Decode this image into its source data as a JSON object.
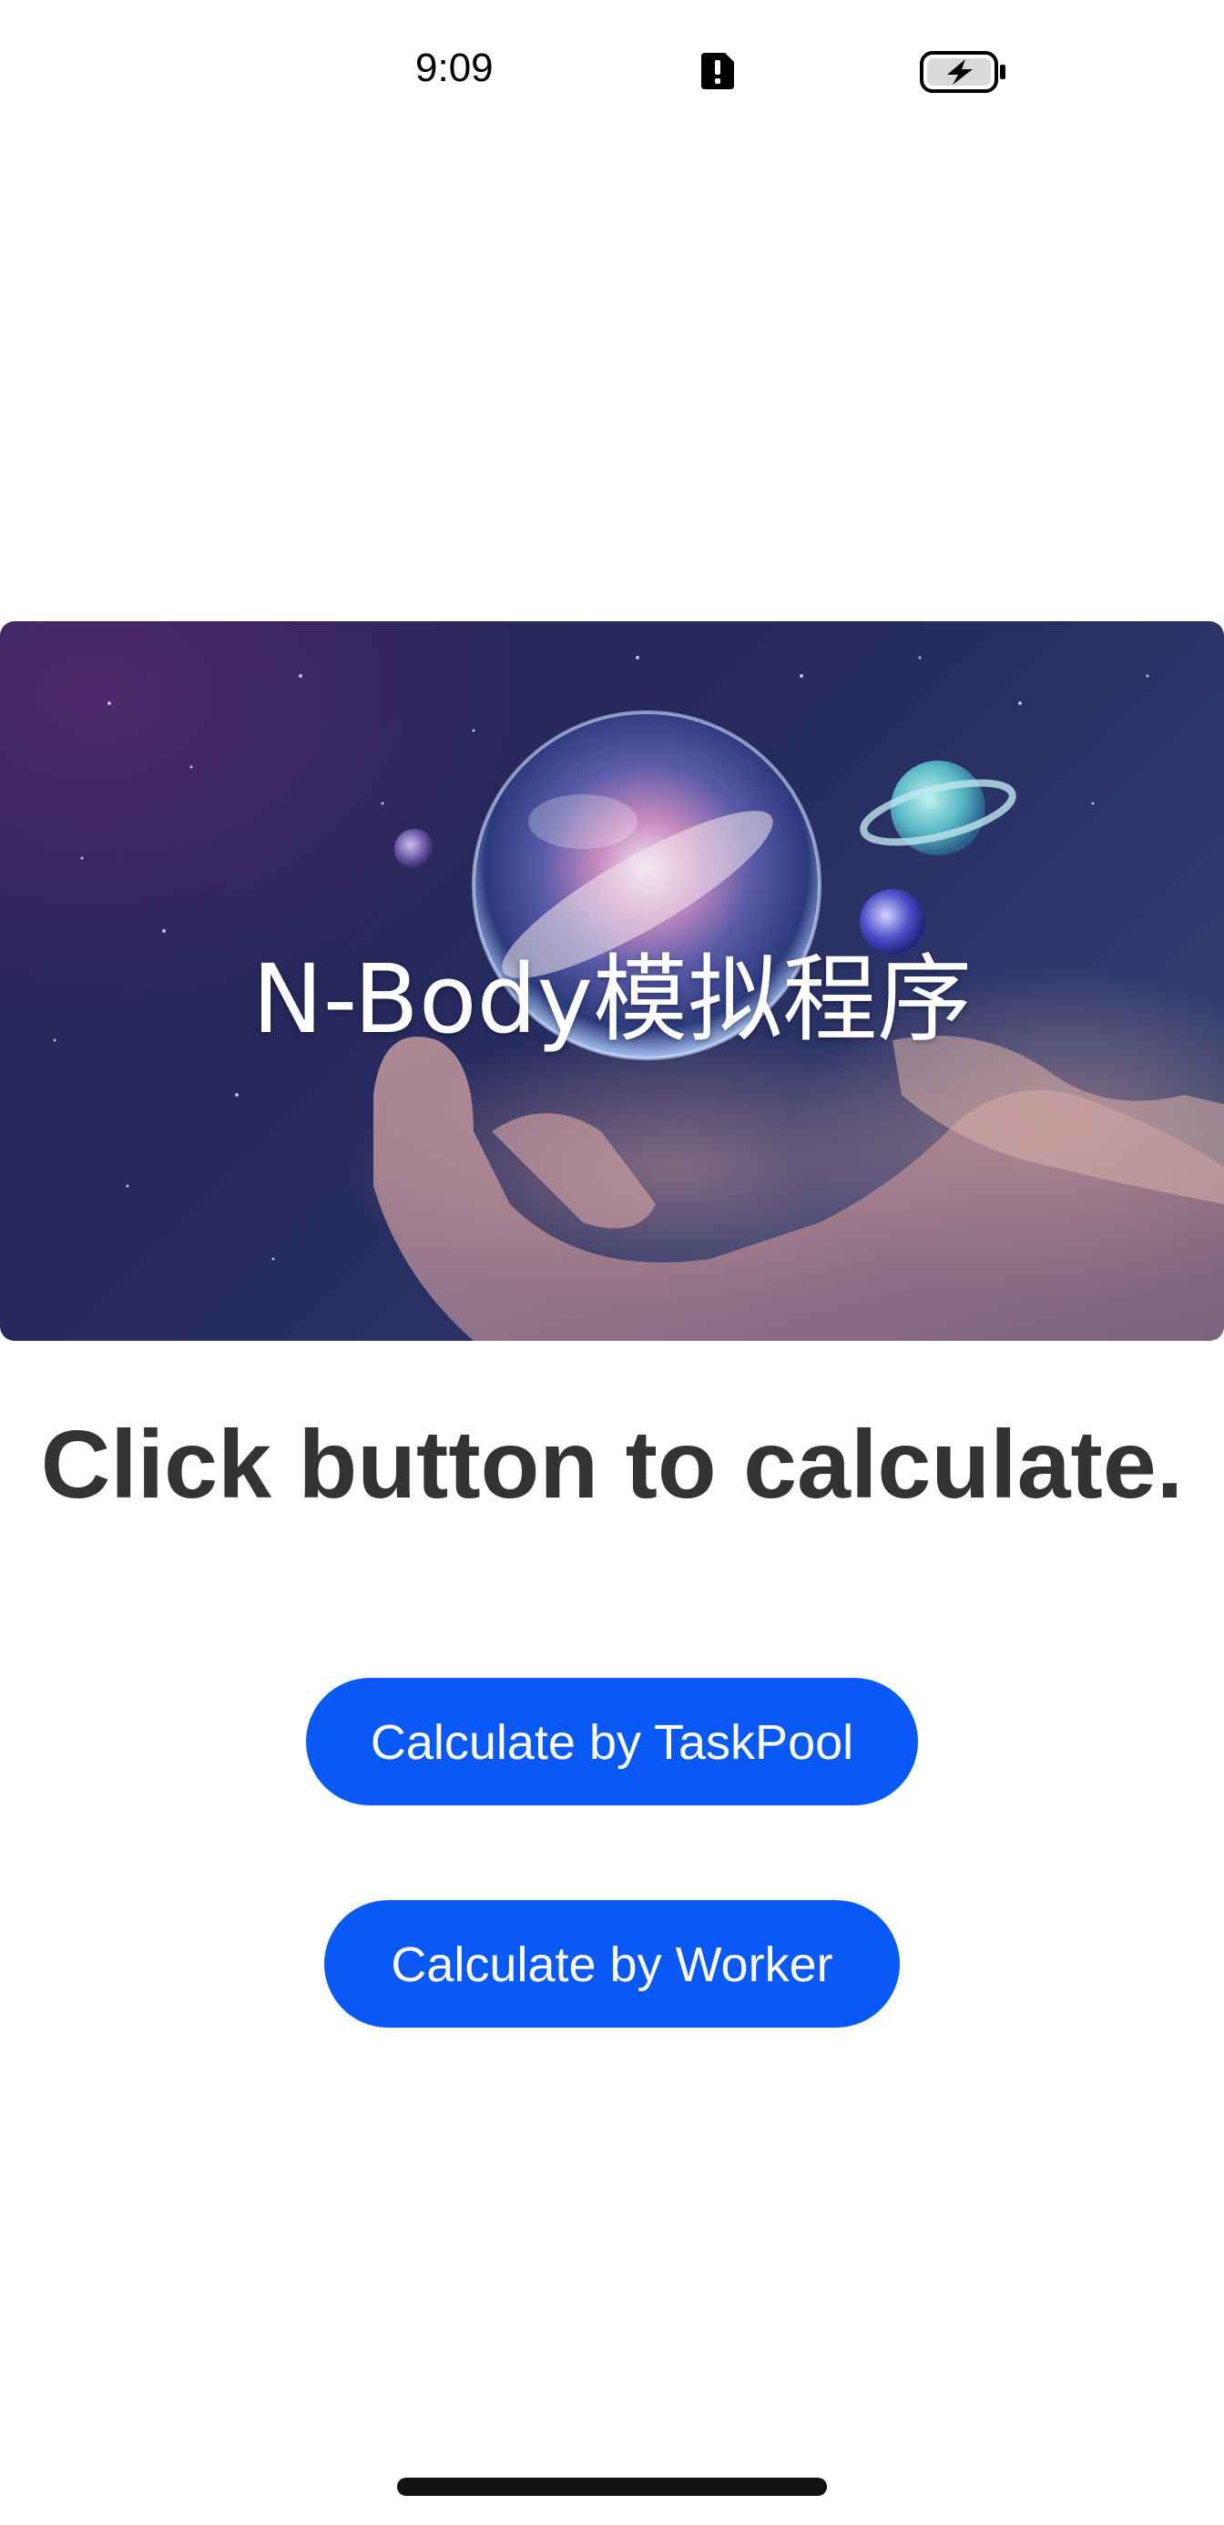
{
  "status_bar": {
    "time": "9:09",
    "icons": [
      "alert-icon",
      "battery-charging-icon"
    ]
  },
  "banner": {
    "title": "N-Body模拟程序",
    "image": "galaxy-in-hands-image"
  },
  "main": {
    "heading": "Click button to calculate.",
    "buttons": {
      "taskpool_label": "Calculate by TaskPool",
      "worker_label": "Calculate by Worker"
    }
  },
  "colors": {
    "button_bg": "#0a59f7",
    "heading_text": "#333333",
    "background": "#ffffff"
  }
}
